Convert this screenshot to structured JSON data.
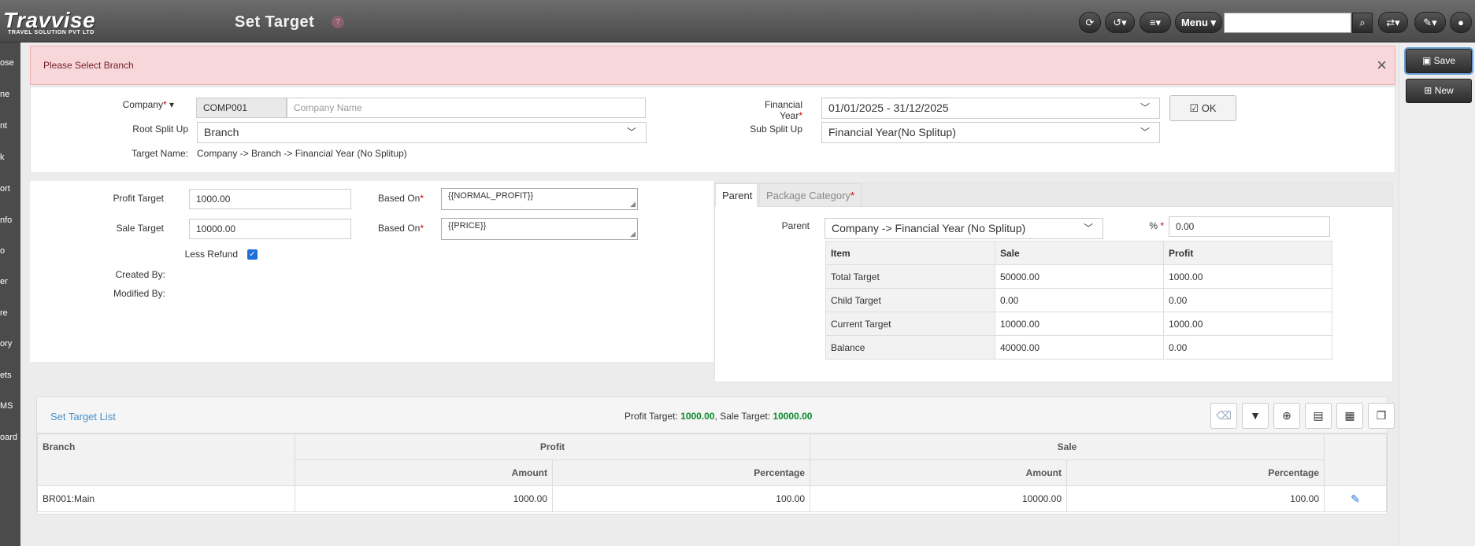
{
  "app": {
    "logo": "Travvise",
    "logo_sub": "TRAVEL SOLUTION PVT LTD",
    "page_title": "Set Target",
    "help": "?"
  },
  "toolbar": {
    "menu_label": "Menu ▾",
    "search_placeholder": "",
    "icons": [
      "refresh-icon",
      "history-icon",
      "list-icon",
      "translate-icon",
      "brush-icon",
      "user-icon"
    ]
  },
  "leftnav": {
    "items": [
      "ose",
      "ne",
      "nt",
      "k",
      "ort",
      "nfo",
      "o",
      "er",
      "re",
      "ory",
      "ets",
      "MS",
      "oard"
    ]
  },
  "rightpanel": {
    "save_label": "Save",
    "new_label": "New"
  },
  "alert": {
    "message": "Please Select Branch",
    "close": "×"
  },
  "form": {
    "company_label": "Company",
    "company_code": "COMP001",
    "company_name_placeholder": "Company Name",
    "root_split_label": "Root Split Up",
    "root_split_value": "Branch",
    "target_name_label": "Target Name:",
    "target_name_value": "Company -> Branch -> Financial Year (No Splitup)",
    "financial_year_label": "Financial Year",
    "financial_year_value": "01/01/2025 - 31/12/2025",
    "sub_split_label": "Sub Split Up",
    "sub_split_value": "Financial Year(No Splitup)",
    "ok_label": "OK"
  },
  "details": {
    "profit_target_label": "Profit Target",
    "profit_target_value": "1000.00",
    "sale_target_label": "Sale Target",
    "sale_target_value": "10000.00",
    "based_on_label": "Based On",
    "profit_based_on": "{{NORMAL_PROFIT}}",
    "sale_based_on": "{{PRICE}}",
    "less_refund_label": "Less Refund",
    "less_refund_checked": true,
    "created_by_label": "Created By:",
    "modified_by_label": "Modified By:"
  },
  "tabs": {
    "parent": "Parent",
    "package_category": "Package Category",
    "parent_label": "Parent",
    "parent_value": "Company -> Financial Year (No Splitup)",
    "percent_label": "%",
    "percent_value": "0.00",
    "table": {
      "headers": [
        "Item",
        "Sale",
        "Profit"
      ],
      "rows": [
        [
          "Total Target",
          "50000.00",
          "1000.00"
        ],
        [
          "Child Target",
          "0.00",
          "0.00"
        ],
        [
          "Current Target",
          "10000.00",
          "1000.00"
        ],
        [
          "Balance",
          "40000.00",
          "0.00"
        ]
      ]
    }
  },
  "list": {
    "title": "Set Target List",
    "profit_target_label": "Profit Target:",
    "profit_target_value": "1000.00",
    "sale_target_label": ", Sale Target:",
    "sale_target_value": "10000.00",
    "col_branch": "Branch",
    "col_profit": "Profit",
    "col_sale": "Sale",
    "col_amount": "Amount",
    "col_percentage": "Percentage",
    "rows": [
      {
        "branch": "BR001:Main",
        "profit_amount": "1000.00",
        "profit_pct": "100.00",
        "sale_amount": "10000.00",
        "sale_pct": "100.00"
      }
    ]
  }
}
